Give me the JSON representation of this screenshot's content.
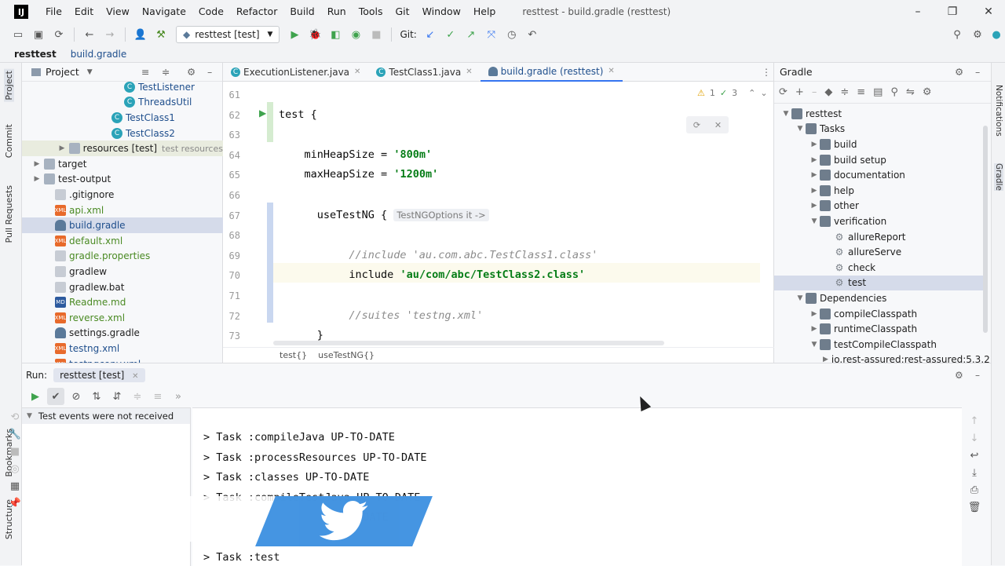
{
  "window": {
    "title": "resttest - build.gradle (resttest)",
    "logo": "IJ"
  },
  "menu": [
    "File",
    "Edit",
    "View",
    "Navigate",
    "Code",
    "Refactor",
    "Build",
    "Run",
    "Tools",
    "Git",
    "Window",
    "Help"
  ],
  "toolbar": {
    "run_config": "resttest [test]",
    "git_label": "Git:"
  },
  "navbar": {
    "root": "resttest",
    "file": "build.gradle"
  },
  "left_stripe": {
    "project": "Project",
    "commit": "Commit",
    "pull_requests": "Pull Requests",
    "bookmarks": "Bookmarks",
    "structure": "Structure"
  },
  "right_stripe": {
    "notifications": "Notifications",
    "gradle": "Gradle"
  },
  "project_panel": {
    "title": "Project",
    "rows": [
      {
        "label": "TestListener",
        "type": "class"
      },
      {
        "label": "ThreadsUtil",
        "type": "class"
      },
      {
        "label": "TestClass1",
        "type": "class"
      },
      {
        "label": "TestClass2",
        "type": "class"
      },
      {
        "label": "resources [test]",
        "hint": "test resources",
        "type": "folder"
      },
      {
        "label": "target",
        "type": "folder"
      },
      {
        "label": "test-output",
        "type": "folder"
      },
      {
        "label": ".gitignore",
        "type": "file"
      },
      {
        "label": "api.xml",
        "type": "xml"
      },
      {
        "label": "build.gradle",
        "type": "gradle"
      },
      {
        "label": "default.xml",
        "type": "xml"
      },
      {
        "label": "gradle.properties",
        "type": "file"
      },
      {
        "label": "gradlew",
        "type": "file"
      },
      {
        "label": "gradlew.bat",
        "type": "file"
      },
      {
        "label": "Readme.md",
        "type": "md"
      },
      {
        "label": "reverse.xml",
        "type": "xml"
      },
      {
        "label": "settings.gradle",
        "type": "gradle"
      },
      {
        "label": "testng.xml",
        "type": "xml"
      },
      {
        "label": "testngcopy.xml",
        "type": "xml"
      }
    ]
  },
  "editor": {
    "tabs": [
      {
        "label": "ExecutionListener.java"
      },
      {
        "label": "TestClass1.java"
      },
      {
        "label": "build.gradle (resttest)"
      }
    ],
    "inspections": {
      "warnings": "1",
      "checks": "3"
    },
    "lines": [
      {
        "n": "61",
        "parts": []
      },
      {
        "n": "62",
        "parts": [
          {
            "t": "test {",
            "c": ""
          }
        ]
      },
      {
        "n": "63",
        "parts": []
      },
      {
        "n": "64",
        "parts": [
          {
            "t": "    minHeapSize = ",
            "c": ""
          },
          {
            "t": "'800m'",
            "c": "kw-str"
          }
        ]
      },
      {
        "n": "65",
        "parts": [
          {
            "t": "    maxHeapSize = ",
            "c": ""
          },
          {
            "t": "'1200m'",
            "c": "kw-str"
          }
        ]
      },
      {
        "n": "66",
        "parts": []
      },
      {
        "n": "67",
        "parts": [
          {
            "t": "      useTestNG { ",
            "c": ""
          },
          {
            "t": "TestNGOptions it ->",
            "c": "kw-hint"
          }
        ]
      },
      {
        "n": "68",
        "parts": []
      },
      {
        "n": "69",
        "parts": [
          {
            "t": "           //include 'au.com.abc.TestClass1.class'",
            "c": "kw-cmt"
          }
        ]
      },
      {
        "n": "70",
        "parts": [
          {
            "t": "           include ",
            "c": ""
          },
          {
            "t": "'au/com/abc/TestClass2.class'",
            "c": "kw-str"
          }
        ]
      },
      {
        "n": "71",
        "parts": []
      },
      {
        "n": "72",
        "parts": [
          {
            "t": "           //suites 'testng.xml'",
            "c": "kw-cmt"
          }
        ]
      },
      {
        "n": "73",
        "parts": [
          {
            "t": "      }",
            "c": ""
          }
        ]
      }
    ],
    "crumbs": [
      "test{}",
      "useTestNG{}"
    ]
  },
  "gradle_panel": {
    "title": "Gradle",
    "rows": [
      {
        "label": "resttest",
        "level": 0,
        "arrow": "open"
      },
      {
        "label": "Tasks",
        "level": 1,
        "arrow": "open"
      },
      {
        "label": "build",
        "level": 2,
        "arrow": "closed"
      },
      {
        "label": "build setup",
        "level": 2,
        "arrow": "closed"
      },
      {
        "label": "documentation",
        "level": 2,
        "arrow": "closed"
      },
      {
        "label": "help",
        "level": 2,
        "arrow": "closed"
      },
      {
        "label": "other",
        "level": 2,
        "arrow": "closed"
      },
      {
        "label": "verification",
        "level": 2,
        "arrow": "open"
      },
      {
        "label": "allureReport",
        "level": 3,
        "arrow": "none"
      },
      {
        "label": "allureServe",
        "level": 3,
        "arrow": "none"
      },
      {
        "label": "check",
        "level": 3,
        "arrow": "none"
      },
      {
        "label": "test",
        "level": 3,
        "arrow": "none"
      },
      {
        "label": "Dependencies",
        "level": 1,
        "arrow": "open"
      },
      {
        "label": "compileClasspath",
        "level": 2,
        "arrow": "closed"
      },
      {
        "label": "runtimeClasspath",
        "level": 2,
        "arrow": "closed"
      },
      {
        "label": "testCompileClasspath",
        "level": 2,
        "arrow": "open"
      },
      {
        "label": "io.rest-assured:rest-assured:5.3.2",
        "level": 3,
        "arrow": "closed"
      }
    ]
  },
  "run_panel": {
    "label": "Run:",
    "tab": "resttest [test]",
    "test_status": "Test events were not received",
    "console": [
      "> Task :compileJava UP-TO-DATE",
      "> Task :processResources UP-TO-DATE",
      "> Task :classes UP-TO-DATE",
      "> Task :compileTestJava UP-TO-DATE",
      "                         DATE",
      "",
      "> Task :test"
    ]
  },
  "colors": {
    "accent": "#3574f0",
    "string": "#067d17",
    "selection": "#d5dbea"
  }
}
